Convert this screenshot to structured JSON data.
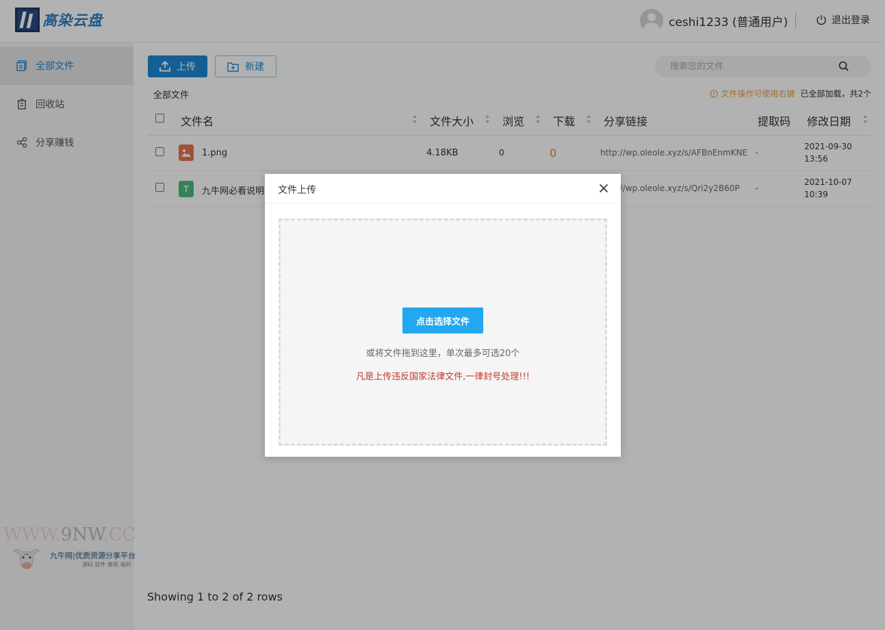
{
  "header": {
    "logo_text": "高染云盘",
    "user_label": "ceshi1233 (普通用户)",
    "logout_label": "退出登录"
  },
  "sidebar": {
    "items": [
      {
        "label": "全部文件",
        "icon": "folder-icon",
        "active": true
      },
      {
        "label": "回收站",
        "icon": "trash-icon",
        "active": false
      },
      {
        "label": "分享赚钱",
        "icon": "share-icon",
        "active": false
      }
    ]
  },
  "toolbar": {
    "upload_label": "上传",
    "new_label": "新建",
    "search_placeholder": "搜索您的文件"
  },
  "breadcrumb": "全部文件",
  "tip": {
    "warning": "文件操作可使用右键",
    "status": "已全部加载，共2个"
  },
  "table": {
    "headers": {
      "name": "文件名",
      "size": "文件大小",
      "views": "浏览",
      "downloads": "下载",
      "share_link": "分享链接",
      "code": "提取码",
      "modified": "修改日期"
    },
    "rows": [
      {
        "name": "1.png",
        "size": "4.18KB",
        "views": "0",
        "downloads": "0",
        "link": "http://wp.oleole.xyz/s/AFBnEnmKNE",
        "code": "-",
        "date": "2021-09-30",
        "time": "13:56",
        "icon": "image-file-icon"
      },
      {
        "name": "九牛网必看说明",
        "size": "",
        "views": "",
        "downloads": "",
        "link": "http://wp.oleole.xyz/s/Qri2y2B60P",
        "code": "-",
        "date": "2021-10-07",
        "time": "10:39",
        "icon": "text-file-icon"
      }
    ]
  },
  "pager_text": "Showing 1 to 2 of 2 rows",
  "modal": {
    "title": "文件上传",
    "pick_button": "点击选择文件",
    "hint": "或将文件拖到这里，单次最多可选20个",
    "warning": "凡是上传违反国家法律文件,一律封号处理!!!"
  },
  "watermark": {
    "url_prefix": "WWW.",
    "url_mid": "9NW",
    "url_suffix": ".CC",
    "name": "九牛网|优质资源分享平台",
    "sub": "源码 软件 教程 福利"
  },
  "colors": {
    "accent": "#1e88d6",
    "pick_button": "#22a7f0",
    "warning_red": "#c0392b",
    "tip_orange": "#e8a04b",
    "download_orange": "#e67e22"
  }
}
